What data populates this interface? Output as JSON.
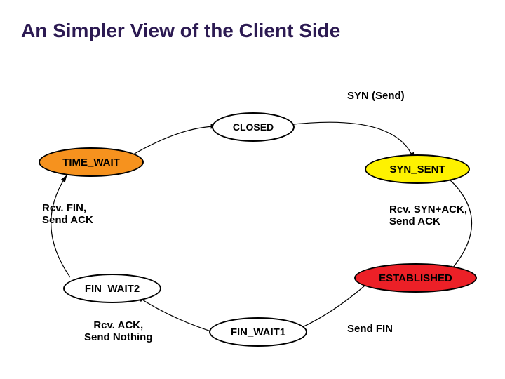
{
  "title": "An Simpler View of the Client Side",
  "nodes": {
    "closed": {
      "label": "CLOSED",
      "fill": "#ffffff"
    },
    "syn_sent": {
      "label": "SYN_SENT",
      "fill": "#fef200"
    },
    "established": {
      "label": "ESTABLISHED",
      "fill": "#ec2027"
    },
    "fin_wait1": {
      "label": "FIN_WAIT1",
      "fill": "#ffffff"
    },
    "fin_wait2": {
      "label": "FIN_WAIT2",
      "fill": "#ffffff"
    },
    "time_wait": {
      "label": "TIME_WAIT",
      "fill": "#f6921e"
    }
  },
  "edge_labels": {
    "closed_to_synsent": "SYN (Send)",
    "synsent_to_established": "Rcv. SYN+ACK,\nSend ACK",
    "established_to_finwait1": "Send FIN",
    "finwait1_to_finwait2": "Rcv. ACK,\nSend Nothing",
    "finwait2_to_timewait": "Rcv. FIN,\nSend ACK"
  },
  "chart_data": {
    "type": "state-diagram",
    "title": "An Simpler View of the Client Side",
    "states": [
      "CLOSED",
      "SYN_SENT",
      "ESTABLISHED",
      "FIN_WAIT1",
      "FIN_WAIT2",
      "TIME_WAIT"
    ],
    "transitions": [
      {
        "from": "CLOSED",
        "to": "SYN_SENT",
        "label": "SYN (Send)"
      },
      {
        "from": "SYN_SENT",
        "to": "ESTABLISHED",
        "label": "Rcv. SYN+ACK, Send ACK"
      },
      {
        "from": "ESTABLISHED",
        "to": "FIN_WAIT1",
        "label": "Send FIN"
      },
      {
        "from": "FIN_WAIT1",
        "to": "FIN_WAIT2",
        "label": "Rcv. ACK, Send Nothing"
      },
      {
        "from": "FIN_WAIT2",
        "to": "TIME_WAIT",
        "label": "Rcv. FIN, Send ACK"
      },
      {
        "from": "TIME_WAIT",
        "to": "CLOSED",
        "label": ""
      }
    ]
  }
}
